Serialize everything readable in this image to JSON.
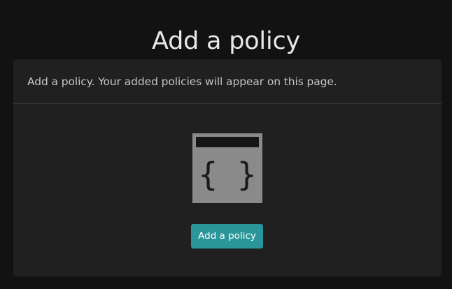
{
  "page": {
    "title": "Add a policy"
  },
  "card": {
    "message": "Add a policy. Your added policies will appear on this page.",
    "illustration_icon": "json-braces-document-icon",
    "illustration_glyph": "{ }",
    "add_button_label": "Add a policy"
  },
  "colors": {
    "background": "#121212",
    "card_background": "#202020",
    "button_accent": "#2a9699",
    "illustration_fill": "#8a8a8a"
  }
}
